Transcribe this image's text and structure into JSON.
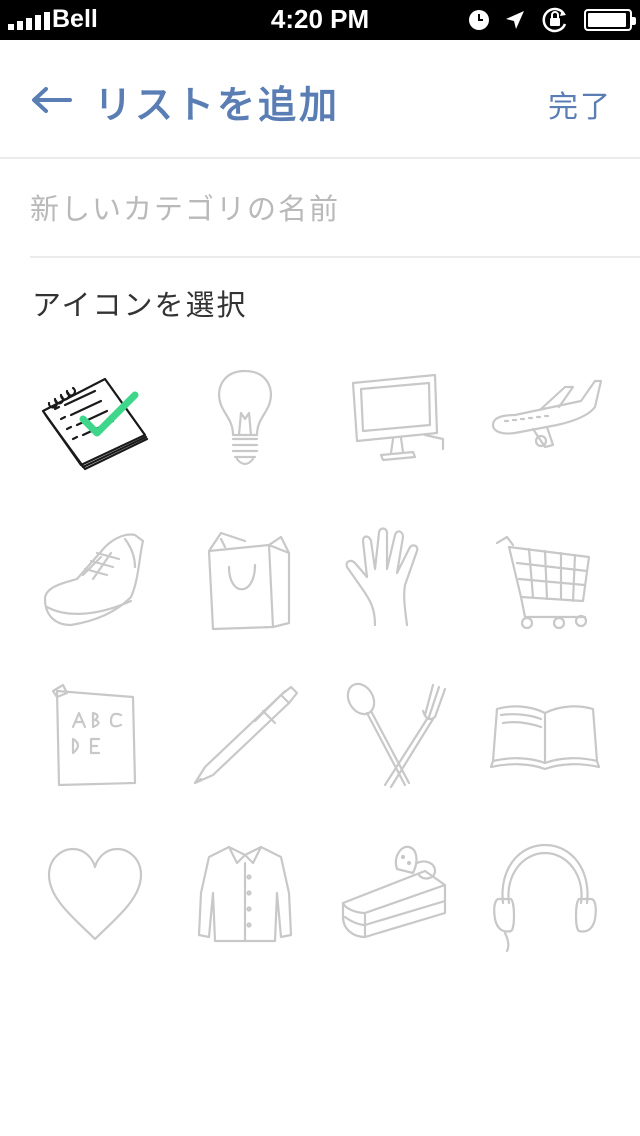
{
  "status_bar": {
    "carrier": "Bell",
    "time": "4:20 PM",
    "battery_level": 0.95
  },
  "nav": {
    "back_icon": "left-arrow-icon",
    "title": "リストを追加",
    "done_label": "完了"
  },
  "category_name": {
    "value": "",
    "placeholder": "新しいカテゴリの名前"
  },
  "icon_section": {
    "label": "アイコンを選択",
    "selected_index": 0,
    "icons": [
      "checklist-icon",
      "lightbulb-icon",
      "computer-icon",
      "airplane-icon",
      "sneaker-icon",
      "shopping-bag-icon",
      "hand-icon",
      "shopping-cart-icon",
      "abc-board-icon",
      "pen-icon",
      "spoon-fork-icon",
      "book-icon",
      "heart-icon",
      "shirt-icon",
      "cake-icon",
      "headphones-icon"
    ]
  },
  "colors": {
    "accent": "#5a7eb4",
    "placeholder": "#b9b9b9",
    "icon_unselected": "#c8c8c8",
    "check": "#3ed68a"
  }
}
